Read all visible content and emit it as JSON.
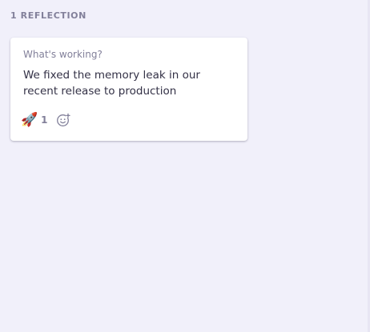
{
  "group": {
    "count_label": "1 REFLECTION"
  },
  "card": {
    "prompt": "What's working?",
    "content": "We fixed the memory leak in our recent release to production",
    "reactions": [
      {
        "emoji_name": "rocket-icon",
        "emoji": "🚀",
        "count": "1"
      }
    ],
    "add_reaction_icon": "add-emoji-icon"
  },
  "colors": {
    "background": "#f1f0fa",
    "card": "#ffffff",
    "muted_text": "#82809a",
    "body_text": "#333146"
  }
}
